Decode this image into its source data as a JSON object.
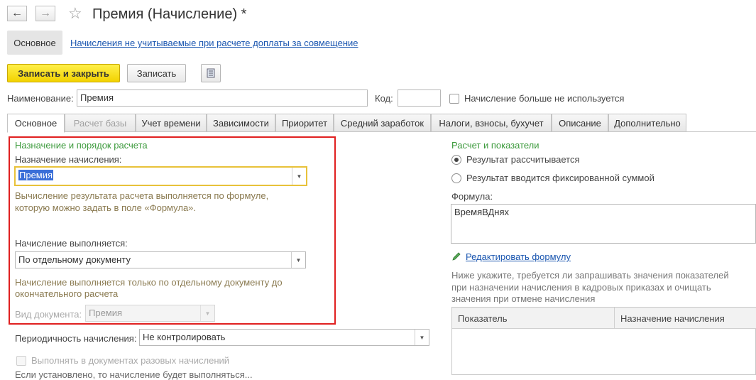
{
  "window": {
    "title": "Премия (Начисление) *",
    "nav_back_icon": "arrow-left-icon",
    "nav_forward_icon": "arrow-right-icon",
    "favorite_icon": "star-icon"
  },
  "section_nav": {
    "main_label": "Основное",
    "link_label": "Начисления не учитываемые при расчете доплаты за совмещение"
  },
  "toolbar": {
    "save_close_label": "Записать и закрыть",
    "save_label": "Записать",
    "more_icon": "list-icon"
  },
  "header_fields": {
    "name_label": "Наименование:",
    "name_value": "Премия",
    "code_label": "Код:",
    "code_value": "",
    "unused_label": "Начисление больше не используется",
    "unused_checked": false
  },
  "tabs": [
    {
      "label": "Основное",
      "state": "active"
    },
    {
      "label": "Расчет базы",
      "state": "disabled"
    },
    {
      "label": "Учет времени",
      "state": "normal"
    },
    {
      "label": "Зависимости",
      "state": "normal"
    },
    {
      "label": "Приоритет",
      "state": "normal"
    },
    {
      "label": "Средний заработок",
      "state": "normal"
    },
    {
      "label": "Налоги, взносы, бухучет",
      "state": "normal"
    },
    {
      "label": "Описание",
      "state": "normal"
    },
    {
      "label": "Дополнительно",
      "state": "normal"
    }
  ],
  "left_panel": {
    "section_title": "Назначение и порядок расчета",
    "purpose_label": "Назначение начисления:",
    "purpose_value": "Премия",
    "purpose_hint_line1": "Вычисление результата расчета выполняется по формуле,",
    "purpose_hint_line2": "которую можно задать в поле «Формула».",
    "executed_label": "Начисление выполняется:",
    "executed_value": "По отдельному документу",
    "executed_hint_line1": "Начисление выполняется только по отдельному документу до",
    "executed_hint_line2": "окончательного расчета",
    "doc_type_label": "Вид документа:",
    "doc_type_value": "Премия",
    "periodicity_label": "Периодичность начисления:",
    "periodicity_value": "Не контролировать",
    "one_time_label": "Выполнять в документах разовых начислений",
    "one_time_checked": false,
    "cut_text": "Если установлено, то начисление будет выполняться..."
  },
  "right_panel": {
    "section_title": "Расчет и показатели",
    "radio_calculated": "Результат рассчитывается",
    "radio_fixed": "Результат вводится фиксированной суммой",
    "selected_radio": "calculated",
    "formula_label": "Формула:",
    "formula_value": "ВремяВДнях",
    "edit_formula_link": "Редактировать формулу",
    "edit_icon": "pencil-icon",
    "indicators_hint_line1": "Ниже укажите, требуется ли запрашивать значения показателей",
    "indicators_hint_line2": "при назначении начисления в кадровых приказах и очищать",
    "indicators_hint_line3": "значения при отмене начисления",
    "table_headers": [
      "Показатель",
      "Назначение начисления"
    ]
  },
  "colors": {
    "primary_button": "#f5d90a",
    "section_title": "#3c9a3c",
    "link": "#1a56b0",
    "highlight_frame": "#e02020",
    "focus_border": "#e8c23a"
  }
}
